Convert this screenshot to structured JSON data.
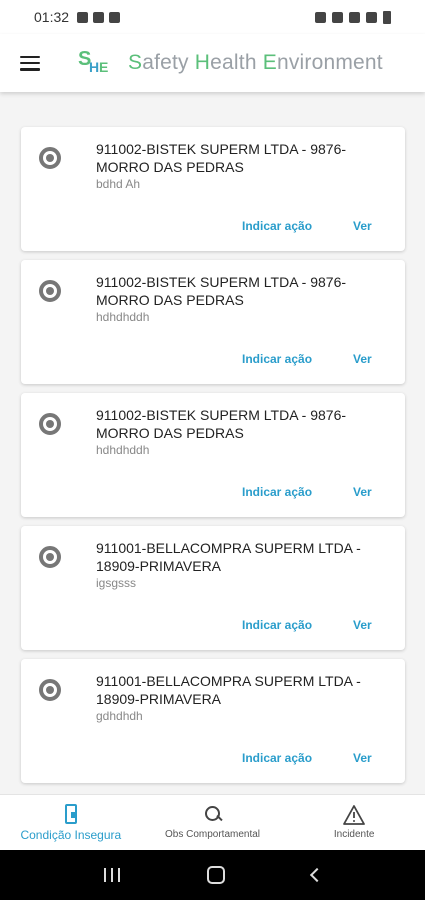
{
  "status_bar": {
    "time": "01:32"
  },
  "app_bar": {
    "logo_letters": [
      "S",
      "H",
      "E"
    ],
    "title_parts": [
      {
        "accent": "S",
        "rest": "afety "
      },
      {
        "accent": "H",
        "rest": "ealth "
      },
      {
        "accent": "E",
        "rest": "nvironment"
      }
    ]
  },
  "records": [
    {
      "title": "911002-BISTEK SUPERM LTDA - 9876-MORRO DAS PEDRAS",
      "subtitle": "bdhd Ah",
      "action_label": "Indicar ação",
      "view_label": "Ver"
    },
    {
      "title": "911002-BISTEK SUPERM LTDA - 9876-MORRO DAS PEDRAS",
      "subtitle": "hdhdhddh",
      "action_label": "Indicar ação",
      "view_label": "Ver"
    },
    {
      "title": "911002-BISTEK SUPERM LTDA - 9876-MORRO DAS PEDRAS",
      "subtitle": "hdhdhddh",
      "action_label": "Indicar ação",
      "view_label": "Ver"
    },
    {
      "title": "911001-BELLACOMPRA SUPERM LTDA - 18909-PRIMAVERA",
      "subtitle": "igsgsss",
      "action_label": "Indicar ação",
      "view_label": "Ver"
    },
    {
      "title": "911001-BELLACOMPRA SUPERM LTDA - 18909-PRIMAVERA",
      "subtitle": "gdhdhdh",
      "action_label": "Indicar ação",
      "view_label": "Ver"
    }
  ],
  "bottom_nav": [
    {
      "label": "Condição Insegura",
      "icon": "phone-alert-icon",
      "active": true
    },
    {
      "label": "Obs Comportamental",
      "icon": "search-icon",
      "active": false
    },
    {
      "label": "Incidente",
      "icon": "warning-icon",
      "active": false
    }
  ],
  "colors": {
    "accent_blue": "#2a9dcb",
    "accent_green": "#5bbf7a",
    "title_gray": "#9aa0a6"
  }
}
